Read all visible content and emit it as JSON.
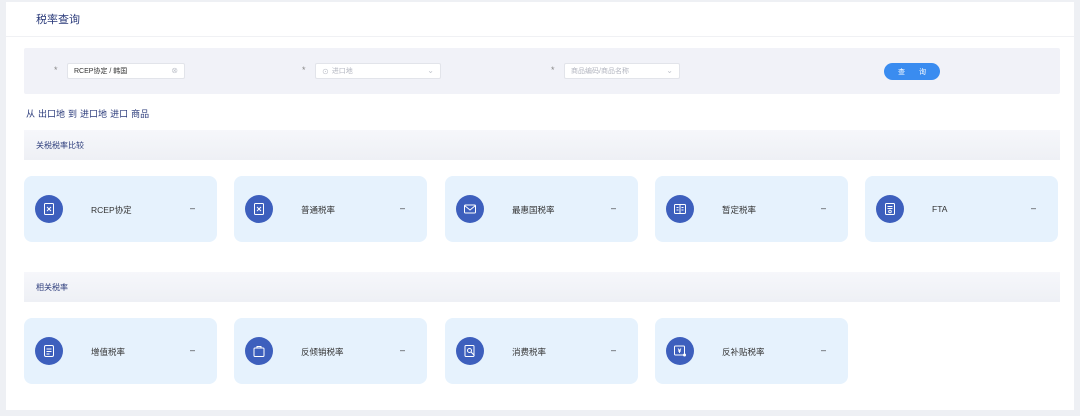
{
  "header": {
    "title": "税率查询"
  },
  "search": {
    "agreement": {
      "required_mark": "*",
      "value": "RCEP协定 / 韩国",
      "clear_icon": "clear-circle-icon"
    },
    "import_country": {
      "required_mark": "*",
      "placeholder": "进口地",
      "prefix_icon": "location-icon",
      "suffix_icon": "chevron-down-icon"
    },
    "product": {
      "required_mark": "*",
      "placeholder": "商品编码/商品名称",
      "suffix_icon": "chevron-down-icon"
    },
    "query_label": "查 询"
  },
  "route": {
    "from": "从",
    "origin": "出口地",
    "to": "到",
    "destination": "进口地",
    "import": "进口",
    "goods": "商品"
  },
  "sections": {
    "tariff": {
      "title": "关税税率比较",
      "cards": [
        {
          "label": "RCEP协定",
          "value": "–",
          "icon": "document-x-icon"
        },
        {
          "label": "普通税率",
          "value": "–",
          "icon": "document-x-icon"
        },
        {
          "label": "最惠国税率",
          "value": "–",
          "icon": "envelope-icon"
        },
        {
          "label": "暂定税率",
          "value": "–",
          "icon": "grid-icon"
        },
        {
          "label": "FTA",
          "value": "–",
          "icon": "certificate-icon"
        }
      ]
    },
    "related": {
      "title": "相关税率",
      "cards": [
        {
          "label": "增值税率",
          "value": "–",
          "icon": "list-doc-icon"
        },
        {
          "label": "反倾销税率",
          "value": "–",
          "icon": "bag-icon"
        },
        {
          "label": "消费税率",
          "value": "–",
          "icon": "search-doc-icon"
        },
        {
          "label": "反补贴税率",
          "value": "–",
          "icon": "yen-doc-icon"
        }
      ]
    }
  },
  "colors": {
    "accent": "#3a8cf0",
    "icon_bg": "#3d5fbd",
    "card_bg": "#e6f2fd",
    "title": "#2a3a7a"
  }
}
